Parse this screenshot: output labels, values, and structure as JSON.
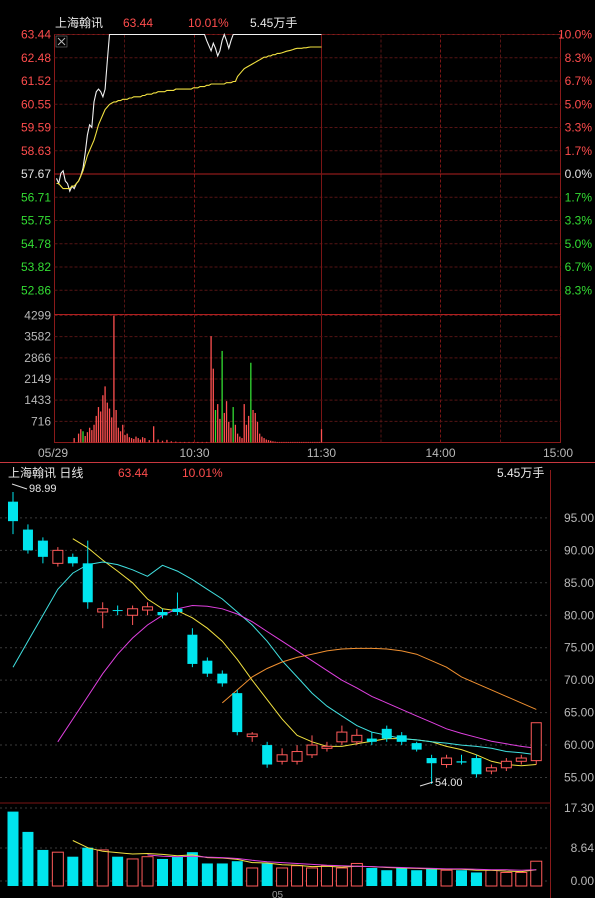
{
  "intraday": {
    "stock_name": "上海翰讯",
    "last_price": "63.44",
    "change_pct": "10.01%",
    "volume": "5.45万手",
    "close_icon": "close-icon",
    "price_ticks": [
      "63.44",
      "62.48",
      "61.52",
      "60.55",
      "59.59",
      "58.63",
      "57.67",
      "56.71",
      "55.75",
      "54.78",
      "53.82",
      "52.86"
    ],
    "pct_ticks": [
      "10.0%",
      "8.3%",
      "6.7%",
      "5.0%",
      "3.3%",
      "1.7%",
      "0.0%",
      "1.7%",
      "3.3%",
      "5.0%",
      "6.7%",
      "8.3%"
    ],
    "volume_ticks": [
      "4299",
      "3582",
      "2866",
      "2149",
      "1433",
      "716"
    ],
    "time_ticks": [
      "05/29",
      "10:30",
      "11:30",
      "14:00",
      "15:00"
    ]
  },
  "daily": {
    "title": "上海翰讯 日线",
    "last_price": "63.44",
    "change_pct": "10.01%",
    "volume": "5.45万手",
    "price_ticks": [
      "95.00",
      "90.00",
      "85.00",
      "80.00",
      "75.00",
      "70.00",
      "65.00",
      "60.00",
      "55.00"
    ],
    "volume_ticks": [
      "17.30",
      "8.64",
      "0.00"
    ],
    "high_annotation": "98.99",
    "low_annotation": "54.00",
    "bottom_label": "05"
  },
  "chart_data": [
    {
      "type": "line",
      "name": "intraday",
      "ylim": [
        52.86,
        63.44
      ],
      "prev_close": 57.67,
      "x_labels": [
        "05/29",
        "10:30",
        "11:30",
        "14:00",
        "15:00"
      ],
      "price_minutes": [
        0,
        1,
        2,
        3,
        4,
        5,
        6,
        7,
        8,
        9,
        10,
        11,
        12,
        13,
        14,
        15,
        16,
        17,
        18,
        19,
        20,
        21,
        22,
        23,
        24,
        25,
        26,
        27,
        28,
        29,
        30,
        31,
        32,
        33,
        34,
        35,
        36,
        37,
        38,
        39,
        40,
        41,
        42,
        43,
        44,
        45,
        46,
        47,
        48,
        49,
        50,
        51,
        52,
        53,
        54,
        55,
        56,
        57,
        58,
        59,
        60,
        61,
        62,
        63,
        64,
        65,
        66,
        67,
        68,
        69,
        70,
        71,
        72,
        73,
        74,
        75,
        76,
        77,
        78,
        79,
        80,
        81,
        82,
        83,
        84,
        85,
        86,
        87,
        88,
        89,
        90,
        91,
        92,
        93,
        94,
        95,
        96,
        97,
        98,
        99,
        100,
        101,
        102,
        103,
        104,
        105,
        106,
        107,
        108,
        109,
        110,
        111,
        112,
        113,
        114,
        115,
        116,
        117,
        118,
        119,
        120
      ],
      "price": [
        57.8,
        57.6,
        58.0,
        58.1,
        57.7,
        57.6,
        57.3,
        57.5,
        57.4,
        57.6,
        57.7,
        57.9,
        58.2,
        58.8,
        59.5,
        59.9,
        59.8,
        60.8,
        61.2,
        61.3,
        61.2,
        61.0,
        61.3,
        62.4,
        63.44,
        63.44,
        63.44,
        63.44,
        63.44,
        63.44,
        63.44,
        63.44,
        63.44,
        63.44,
        63.44,
        63.44,
        63.44,
        63.44,
        63.44,
        63.44,
        63.44,
        63.44,
        63.44,
        63.44,
        63.44,
        63.44,
        63.44,
        63.44,
        63.44,
        63.44,
        63.44,
        63.44,
        63.44,
        63.44,
        63.44,
        63.44,
        63.44,
        63.44,
        63.44,
        63.44,
        63.44,
        63.44,
        63.44,
        63.44,
        63.44,
        63.44,
        63.44,
        63.44,
        63.44,
        63.44,
        63.44,
        63.44,
        63.44,
        63.44,
        63.44,
        63.44,
        63.44,
        63.44,
        63.44,
        63.44,
        63.44,
        63.44,
        63.44,
        63.44,
        63.44,
        63.44,
        63.44,
        63.44,
        63.44,
        63.44,
        63.44,
        63.44,
        63.44,
        63.44,
        63.44,
        63.44,
        63.44,
        63.44,
        63.44,
        63.44,
        63.44,
        63.44,
        63.44,
        63.44,
        63.44,
        63.44,
        63.44,
        63.44,
        63.44,
        63.44,
        63.44,
        63.44,
        63.44,
        63.44,
        63.44,
        63.44,
        63.44
      ],
      "price_dip_minutes": [
        64,
        65,
        66,
        67,
        68,
        69,
        70,
        71,
        72,
        73,
        74,
        75,
        76,
        77,
        78,
        79,
        80,
        81,
        82,
        83,
        84,
        85,
        86,
        87,
        88,
        89,
        90,
        91,
        92,
        93,
        94,
        95,
        96,
        97,
        98,
        99,
        100,
        101,
        102,
        103,
        104,
        105,
        106,
        107,
        108,
        109,
        110,
        111,
        112,
        113,
        114,
        115,
        116,
        117,
        118,
        119,
        120
      ],
      "price_dip": [
        63.44,
        63.44,
        63.44,
        63.44,
        63.2,
        63.0,
        62.8,
        63.1,
        62.9,
        62.6,
        62.8,
        63.2,
        63.44,
        63.2,
        62.9,
        63.2,
        63.44,
        63.44,
        63.44,
        63.44,
        63.44,
        63.44,
        63.44,
        63.44,
        63.44,
        63.44,
        63.44,
        63.44,
        63.44,
        63.44,
        63.44,
        63.44,
        63.44,
        63.44,
        63.44,
        63.44,
        63.44,
        63.44,
        63.44,
        63.44,
        63.44,
        63.44,
        63.44,
        63.44,
        63.44,
        63.44,
        63.44,
        63.44,
        63.44,
        63.44,
        63.44,
        63.44,
        63.44,
        63.44,
        63.44,
        63.44,
        63.44
      ],
      "avg_price": [
        57.6,
        57.6,
        57.5,
        57.4,
        57.4,
        57.4,
        57.4,
        57.5,
        57.5,
        57.6,
        57.7,
        57.9,
        58.1,
        58.4,
        58.7,
        58.9,
        59.1,
        59.3,
        59.6,
        59.9,
        60.1,
        60.3,
        60.5,
        60.6,
        60.7,
        60.75,
        60.8,
        60.8,
        60.85,
        60.85,
        60.9,
        60.9,
        60.9,
        60.95,
        60.95,
        61.0,
        61.0,
        61.0,
        61.0,
        61.05,
        61.05,
        61.1,
        61.1,
        61.1,
        61.15,
        61.15,
        61.2,
        61.2,
        61.2,
        61.2,
        61.25,
        61.25,
        61.25,
        61.25,
        61.3,
        61.3,
        61.3,
        61.3,
        61.3,
        61.3,
        61.3,
        61.3,
        61.35,
        61.35,
        61.35,
        61.4,
        61.4,
        61.4,
        61.45,
        61.45,
        61.5,
        61.5,
        61.5,
        61.5,
        61.5,
        61.5,
        61.5,
        61.55,
        61.55,
        61.55,
        61.6,
        61.6,
        61.8,
        61.9,
        62.0,
        62.1,
        62.15,
        62.2,
        62.25,
        62.3,
        62.35,
        62.4,
        62.45,
        62.5,
        62.55,
        62.55,
        62.6,
        62.6,
        62.65,
        62.65,
        62.7,
        62.7,
        62.72,
        62.75,
        62.78,
        62.8,
        62.82,
        62.85,
        62.88,
        62.9,
        62.9,
        62.9,
        62.92,
        62.92,
        62.94,
        62.95,
        62.95,
        62.95,
        62.95,
        62.95,
        62.95
      ],
      "volume_max": 4299,
      "volume_minutes": [
        8,
        10,
        11,
        12,
        13,
        14,
        15,
        16,
        17,
        18,
        19,
        20,
        21,
        22,
        23,
        24,
        25,
        26,
        27,
        28,
        29,
        30,
        31,
        32,
        33,
        34,
        35,
        36,
        37,
        38,
        39,
        40,
        42,
        44,
        46,
        48,
        50,
        52,
        54,
        56,
        58,
        60,
        62,
        64,
        66,
        68,
        70,
        71,
        72,
        73,
        74,
        75,
        76,
        77,
        78,
        79,
        80,
        81,
        82,
        83,
        84,
        85,
        86,
        87,
        88,
        89,
        90,
        91,
        92,
        93,
        94,
        95,
        96,
        97,
        98,
        99,
        100,
        101,
        102,
        103,
        104,
        105,
        106,
        107,
        108,
        109,
        110,
        111,
        112,
        113,
        114,
        115,
        116,
        117,
        118,
        119,
        120
      ],
      "volume": [
        150,
        300,
        450,
        380,
        220,
        350,
        500,
        420,
        600,
        900,
        1200,
        1050,
        1600,
        1900,
        1350,
        1150,
        850,
        4300,
        1100,
        500,
        380,
        600,
        250,
        300,
        180,
        150,
        120,
        200,
        150,
        100,
        180,
        150,
        80,
        550,
        100,
        60,
        90,
        40,
        30,
        20,
        20,
        20,
        20,
        20,
        20,
        20,
        3600,
        2500,
        1100,
        1300,
        800,
        3100,
        1000,
        1400,
        700,
        500,
        1200,
        600,
        300,
        200,
        150,
        1300,
        600,
        900,
        2700,
        1100,
        1000,
        700,
        300,
        200,
        150,
        100,
        80,
        60,
        40,
        30,
        20,
        20,
        20,
        20,
        20,
        20,
        20,
        20,
        20,
        20,
        20,
        20,
        20,
        20,
        20,
        20,
        20,
        20,
        20,
        20,
        450
      ],
      "volume_colors": [
        "red",
        "red",
        "red",
        "green",
        "red",
        "red",
        "red",
        "red",
        "red",
        "red",
        "red",
        "red",
        "red",
        "red",
        "red",
        "red",
        "red",
        "red",
        "red",
        "red",
        "red",
        "red",
        "red",
        "red",
        "red",
        "red",
        "red",
        "red",
        "red",
        "red",
        "red",
        "red",
        "red",
        "red",
        "red",
        "red",
        "red",
        "red",
        "red",
        "red",
        "red",
        "red",
        "red",
        "red",
        "red",
        "red",
        "red",
        "red",
        "green",
        "red",
        "red",
        "green",
        "red",
        "red",
        "red",
        "red",
        "green",
        "red",
        "red",
        "red",
        "red",
        "red",
        "red",
        "red",
        "green",
        "red",
        "red",
        "red",
        "red",
        "red",
        "red",
        "red",
        "red",
        "red",
        "red",
        "red",
        "red",
        "red",
        "red",
        "red",
        "red",
        "red",
        "red",
        "red",
        "red",
        "red",
        "red",
        "red",
        "red",
        "red",
        "red",
        "red",
        "red",
        "red",
        "red",
        "red",
        "red"
      ]
    },
    {
      "type": "candlestick",
      "name": "daily",
      "ylim": [
        53.5,
        99.5
      ],
      "candles": [
        {
          "o": 97.5,
          "c": 94.5,
          "h": 98.99,
          "l": 92.5
        },
        {
          "o": 93.2,
          "c": 90.0,
          "h": 94.0,
          "l": 89.5
        },
        {
          "o": 91.5,
          "c": 89.0,
          "h": 92.0,
          "l": 88.0
        },
        {
          "o": 88.0,
          "c": 90.0,
          "h": 90.5,
          "l": 87.5
        },
        {
          "o": 89.0,
          "c": 88.0,
          "h": 89.5,
          "l": 87.5
        },
        {
          "o": 88.0,
          "c": 82.0,
          "h": 91.5,
          "l": 81.0
        },
        {
          "o": 80.5,
          "c": 81.0,
          "h": 82.0,
          "l": 78.0
        },
        {
          "o": 80.8,
          "c": 80.7,
          "h": 81.5,
          "l": 80.0
        },
        {
          "o": 80.0,
          "c": 81.0,
          "h": 81.5,
          "l": 78.5
        },
        {
          "o": 80.8,
          "c": 81.3,
          "h": 82.0,
          "l": 80.0
        },
        {
          "o": 80.5,
          "c": 80.0,
          "h": 81.0,
          "l": 79.5
        },
        {
          "o": 81.0,
          "c": 80.5,
          "h": 83.5,
          "l": 80.0
        },
        {
          "o": 77.0,
          "c": 72.5,
          "h": 78.0,
          "l": 72.0
        },
        {
          "o": 73.0,
          "c": 71.0,
          "h": 73.5,
          "l": 70.5
        },
        {
          "o": 71.0,
          "c": 69.5,
          "h": 71.5,
          "l": 69.0
        },
        {
          "o": 68.0,
          "c": 62.0,
          "h": 68.5,
          "l": 61.5
        },
        {
          "o": 61.3,
          "c": 61.7,
          "h": 62.0,
          "l": 60.5
        },
        {
          "o": 60.0,
          "c": 57.0,
          "h": 60.5,
          "l": 56.5
        },
        {
          "o": 57.5,
          "c": 58.5,
          "h": 59.5,
          "l": 57.0
        },
        {
          "o": 57.5,
          "c": 59.0,
          "h": 60.0,
          "l": 57.0
        },
        {
          "o": 58.5,
          "c": 60.0,
          "h": 61.5,
          "l": 58.0
        },
        {
          "o": 59.5,
          "c": 59.8,
          "h": 60.5,
          "l": 59.0
        },
        {
          "o": 60.5,
          "c": 62.0,
          "h": 63.0,
          "l": 60.0
        },
        {
          "o": 60.5,
          "c": 61.5,
          "h": 62.5,
          "l": 60.0
        },
        {
          "o": 61.0,
          "c": 60.5,
          "h": 62.0,
          "l": 60.0
        },
        {
          "o": 62.5,
          "c": 61.0,
          "h": 63.0,
          "l": 60.5
        },
        {
          "o": 61.5,
          "c": 60.5,
          "h": 62.0,
          "l": 60.0
        },
        {
          "o": 60.3,
          "c": 59.3,
          "h": 60.5,
          "l": 59.0
        },
        {
          "o": 58.0,
          "c": 57.2,
          "h": 58.5,
          "l": 54.0
        },
        {
          "o": 57.0,
          "c": 58.0,
          "h": 58.5,
          "l": 56.5
        },
        {
          "o": 57.5,
          "c": 57.3,
          "h": 58.5,
          "l": 57.0
        },
        {
          "o": 58.0,
          "c": 55.5,
          "h": 58.5,
          "l": 55.0
        },
        {
          "o": 56.0,
          "c": 56.5,
          "h": 57.0,
          "l": 55.5
        },
        {
          "o": 56.5,
          "c": 57.5,
          "h": 58.0,
          "l": 56.0
        },
        {
          "o": 57.5,
          "c": 58.0,
          "h": 58.5,
          "l": 57.0
        },
        {
          "o": 57.6,
          "c": 63.44,
          "h": 63.44,
          "l": 57.0
        }
      ],
      "ma5": [
        null,
        null,
        null,
        null,
        91.8,
        90.4,
        88.5,
        86.8,
        85.0,
        82.5,
        81.0,
        80.7,
        79.6,
        78.0,
        76.0,
        73.2,
        70.0,
        67.0,
        64.0,
        61.5,
        60.5,
        59.8,
        59.8,
        60.2,
        60.6,
        61.0,
        61.0,
        60.8,
        60.5,
        59.8,
        59.3,
        58.5,
        57.5,
        57.0,
        56.8,
        57.0
      ],
      "ma10": [
        null,
        null,
        null,
        null,
        null,
        null,
        null,
        null,
        null,
        89.0,
        87.7,
        86.8,
        85.5,
        84.0,
        82.5,
        80.5,
        78.5,
        76.0,
        73.0,
        70.5,
        68.0,
        66.0,
        64.5,
        63.0,
        62.0,
        61.5,
        61.0,
        60.8,
        60.5,
        60.3,
        60.0,
        59.8,
        59.5,
        59.0,
        58.8,
        58.5
      ],
      "ma20": [
        null,
        null,
        null,
        null,
        null,
        null,
        null,
        null,
        null,
        null,
        null,
        null,
        null,
        null,
        null,
        null,
        null,
        null,
        null,
        null,
        75.5,
        78.5,
        80.0,
        81.0,
        81.5,
        81.3,
        80.8,
        79.8,
        78.5,
        77.0,
        75.0,
        72.5,
        70.0,
        68.0,
        66.5,
        65.5
      ],
      "ma30": [
        null,
        null,
        null,
        null,
        null,
        null,
        null,
        null,
        null,
        null,
        null,
        null,
        null,
        null,
        null,
        null,
        null,
        null,
        null,
        null,
        null,
        null,
        null,
        null,
        null,
        null,
        null,
        null,
        null,
        null,
        null,
        null,
        null,
        null,
        null,
        null
      ],
      "volume_max": 17.3,
      "volume": [
        16.5,
        12.0,
        8.0,
        7.5,
        6.5,
        8.5,
        8.0,
        6.5,
        6.0,
        6.5,
        6.0,
        6.5,
        7.5,
        5.0,
        5.0,
        5.5,
        4.0,
        5.0,
        4.0,
        4.5,
        4.0,
        4.5,
        4.0,
        5.0,
        4.0,
        3.5,
        4.0,
        3.5,
        4.0,
        3.5,
        3.5,
        3.0,
        3.5,
        3.0,
        3.0,
        5.5
      ],
      "volume_ma": [
        null,
        null,
        null,
        null,
        10.1,
        8.5,
        7.7,
        7.4,
        7.1,
        7.2,
        7.0,
        6.7,
        6.9,
        6.3,
        6.2,
        5.9,
        5.2,
        5.1,
        4.7,
        4.6,
        4.3,
        4.4,
        4.2,
        4.4,
        4.3,
        4.1,
        4.0,
        3.9,
        3.8,
        3.7,
        3.7,
        3.5,
        3.5,
        3.3,
        3.2,
        3.6
      ]
    }
  ]
}
